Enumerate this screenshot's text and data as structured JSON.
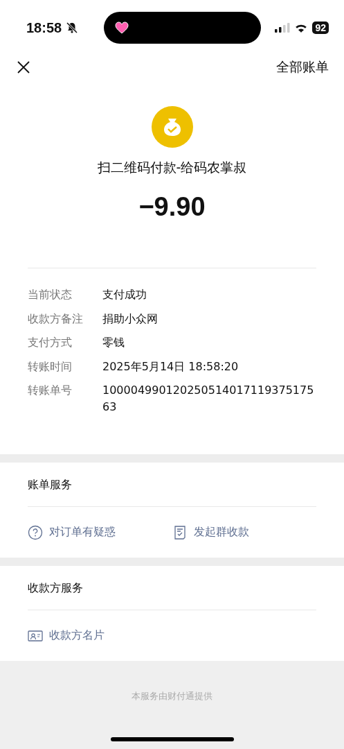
{
  "status_bar": {
    "time": "18:58",
    "battery": "92"
  },
  "nav": {
    "right_link": "全部账单"
  },
  "header": {
    "title": "扫二维码付款-给码农掌叔",
    "amount": "−9.90"
  },
  "details": [
    {
      "label": "当前状态",
      "value": "支付成功"
    },
    {
      "label": "收款方备注",
      "value": "捐助小众网"
    },
    {
      "label": "支付方式",
      "value": "零钱"
    },
    {
      "label": "转账时间",
      "value": "2025年5月14日 18:58:20"
    },
    {
      "label": "转账单号",
      "value": "10000499012025051401711937517563"
    }
  ],
  "sections": [
    {
      "title": "账单服务",
      "actions": [
        {
          "kind": "question",
          "label": "对订单有疑惑"
        },
        {
          "kind": "bill",
          "label": "发起群收款"
        }
      ]
    },
    {
      "title": "收款方服务",
      "actions": [
        {
          "kind": "card",
          "label": "收款方名片"
        }
      ]
    }
  ],
  "footer": "本服务由财付通提供"
}
